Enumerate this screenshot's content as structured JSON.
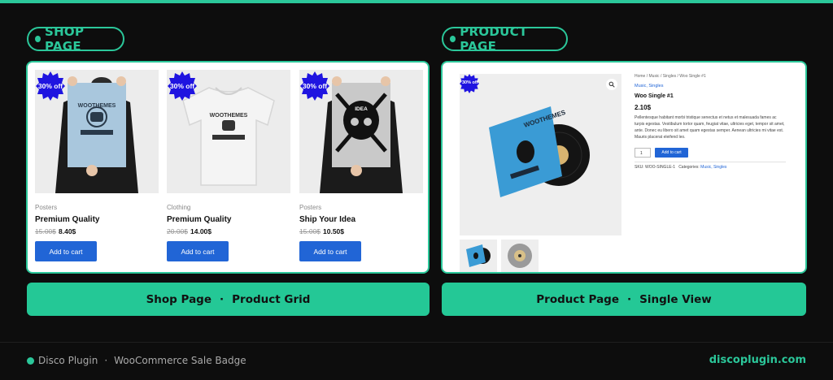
{
  "colors": {
    "accent": "#2bc79a",
    "badge": "#1f14e0",
    "button": "#2165d6"
  },
  "shop": {
    "label": "SHOP PAGE",
    "products": [
      {
        "category": "Posters",
        "title": "Premium Quality",
        "old_price": "15.00$",
        "price": "8.40$",
        "badge": "30% off",
        "button": "Add to cart",
        "image": "poster-icon"
      },
      {
        "category": "Clothing",
        "title": "Premium Quality",
        "old_price": "20.00$",
        "price": "14.00$",
        "badge": "30% off",
        "button": "Add to cart",
        "image": "tshirt-icon"
      },
      {
        "category": "Posters",
        "title": "Ship Your Idea",
        "old_price": "15.00$",
        "price": "10.50$",
        "badge": "30% off",
        "button": "Add to cart",
        "image": "skull-poster-icon"
      }
    ]
  },
  "product": {
    "label": "PRODUCT PAGE",
    "badge": "30% off",
    "breadcrumb": "Home / Music / Singles / Woo Single #1",
    "categories": "Music, Singles",
    "title": "Woo Single #1",
    "price": "2.10$",
    "description": "Pellentesque habitant morbi tristique senectus et netus et malesuada fames ac turpis egestas. Vestibulum tortor quam, feugiat vitae, ultricies eget, tempor sit amet, ante. Donec eu libero sit amet quam egestas semper. Aenean ultricies mi vitae est. Mauris placerat eleifend leo.",
    "quantity": "1",
    "add_button": "Add to cart",
    "sku_label": "SKU: WOO-SINGLE-1",
    "categories_label": "Categories:",
    "categories_links": "Music, Singles"
  },
  "captions": {
    "shop_left": "Shop Page",
    "shop_right": "Product Grid",
    "product_left": "Product Page",
    "product_right": "Single View",
    "separator": "·"
  },
  "footer": {
    "brand": "Disco Plugin",
    "separator": "·",
    "subtitle": "WooCommerce Sale Badge",
    "url": "discoplugin.com"
  }
}
